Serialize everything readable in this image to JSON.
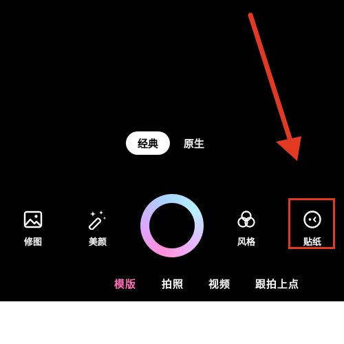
{
  "mode_toggle": {
    "selected": "经典",
    "other": "原生"
  },
  "tools": {
    "edit": {
      "label": "修图",
      "icon": "image-icon"
    },
    "beauty": {
      "label": "美颜",
      "icon": "magic-wand-icon"
    },
    "style": {
      "label": "风格",
      "icon": "three-circles-icon"
    },
    "sticker": {
      "label": "贴纸",
      "icon": "sticker-face-icon"
    }
  },
  "camera_modes": [
    {
      "label": "模版",
      "active": true
    },
    {
      "label": "拍照",
      "active": false
    },
    {
      "label": "视频",
      "active": false
    },
    {
      "label": "跟拍上点",
      "active": false
    }
  ],
  "colors": {
    "background": "#000000",
    "text": "#ffffff",
    "annotation_red": "#e23a22",
    "active_mode": "#ff6fb8"
  }
}
